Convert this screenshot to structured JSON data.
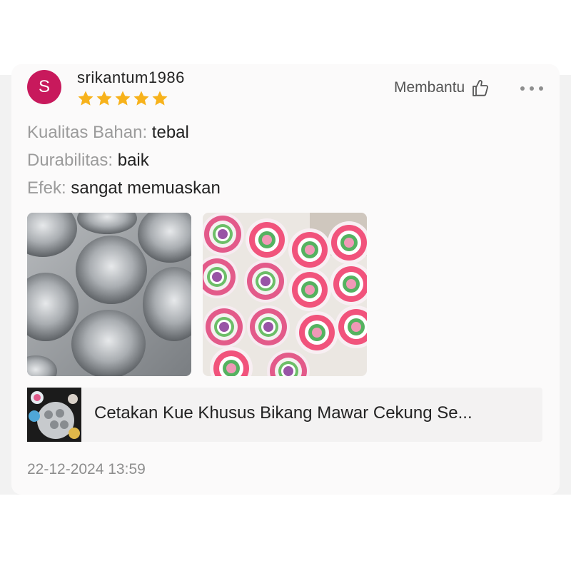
{
  "review": {
    "avatar_letter": "S",
    "username": "srikantum1986",
    "rating": 5,
    "helpful_label": "Membantu",
    "attributes": [
      {
        "label": "Kualitas Bahan:",
        "value": "tebal"
      },
      {
        "label": "Durabilitas:",
        "value": "baik"
      },
      {
        "label": "Efek:",
        "value": "sangat memuaskan"
      }
    ],
    "photos": [
      "aluminum-mold-photo",
      "bikang-cakes-photo"
    ],
    "product_name": "Cetakan Kue Khusus Bikang Mawar Cekung Se...",
    "date": "22-12-2024 13:59"
  },
  "colors": {
    "avatar": "#c8195c",
    "star": "#f7b21b",
    "card_bg": "#fbfafa",
    "product_bg": "#f3f2f2"
  },
  "icons": [
    "thumbs-up-icon",
    "more-options-icon",
    "star-icon"
  ]
}
